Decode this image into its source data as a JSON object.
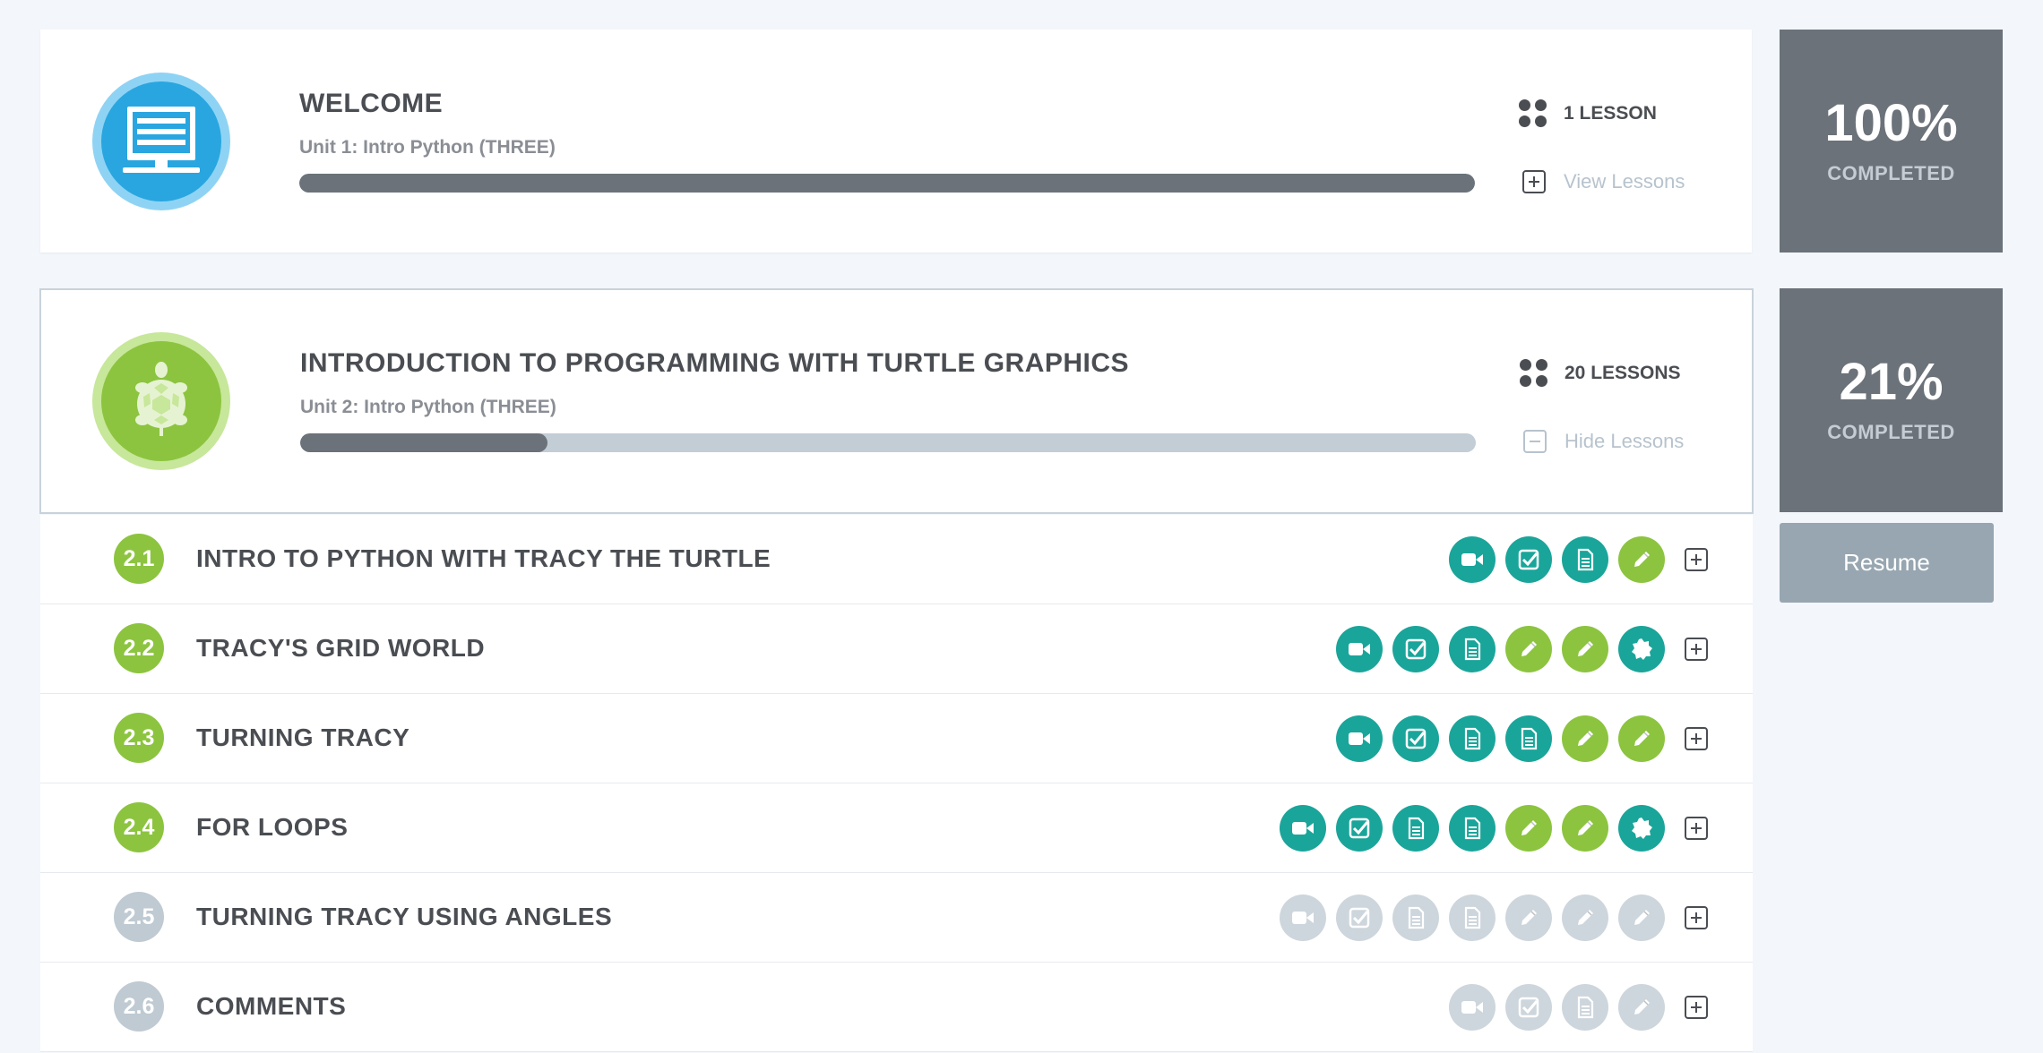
{
  "units": [
    {
      "title": "WELCOME",
      "subtitle": "Unit 1: Intro Python (THREE)",
      "progress": 1.0,
      "lessons_label": "1 LESSON",
      "toggle_label": "View Lessons",
      "percent": "100%",
      "completed_label": "COMPLETED",
      "icon": "monitor-icon",
      "color": "#29a6e0"
    },
    {
      "title": "INTRODUCTION TO PROGRAMMING WITH TURTLE GRAPHICS",
      "subtitle": "Unit 2: Intro Python (THREE)",
      "progress": 0.21,
      "lessons_label": "20 LESSONS",
      "toggle_label": "Hide Lessons",
      "percent": "21%",
      "completed_label": "COMPLETED",
      "icon": "turtle-icon",
      "color": "#8cc43f"
    }
  ],
  "resume_label": "Resume",
  "lessons": [
    {
      "num": "2.1",
      "title": "INTRO TO PYTHON WITH TRACY THE TURTLE",
      "done": true,
      "activities": [
        [
          "video",
          "teal"
        ],
        [
          "quiz",
          "teal"
        ],
        [
          "doc",
          "teal"
        ],
        [
          "exercise",
          "green"
        ]
      ]
    },
    {
      "num": "2.2",
      "title": "TRACY'S GRID WORLD",
      "done": true,
      "activities": [
        [
          "video",
          "teal"
        ],
        [
          "quiz",
          "teal"
        ],
        [
          "doc",
          "teal"
        ],
        [
          "exercise",
          "green"
        ],
        [
          "exercise",
          "green"
        ],
        [
          "badge",
          "teal"
        ]
      ]
    },
    {
      "num": "2.3",
      "title": "TURNING TRACY",
      "done": true,
      "activities": [
        [
          "video",
          "teal"
        ],
        [
          "quiz",
          "teal"
        ],
        [
          "doc",
          "teal"
        ],
        [
          "doc",
          "teal"
        ],
        [
          "exercise",
          "green"
        ],
        [
          "exercise",
          "green"
        ]
      ]
    },
    {
      "num": "2.4",
      "title": "FOR LOOPS",
      "done": true,
      "activities": [
        [
          "video",
          "teal"
        ],
        [
          "quiz",
          "teal"
        ],
        [
          "doc",
          "teal"
        ],
        [
          "doc",
          "teal"
        ],
        [
          "exercise",
          "green"
        ],
        [
          "exercise",
          "green"
        ],
        [
          "badge",
          "teal"
        ]
      ]
    },
    {
      "num": "2.5",
      "title": "TURNING TRACY USING ANGLES",
      "done": false,
      "activities": [
        [
          "video",
          "grey"
        ],
        [
          "quiz",
          "grey"
        ],
        [
          "doc",
          "grey"
        ],
        [
          "doc",
          "grey"
        ],
        [
          "exercise",
          "grey"
        ],
        [
          "exercise",
          "grey"
        ],
        [
          "exercise",
          "grey"
        ]
      ]
    },
    {
      "num": "2.6",
      "title": "COMMENTS",
      "done": false,
      "activities": [
        [
          "video",
          "grey"
        ],
        [
          "quiz",
          "grey"
        ],
        [
          "doc",
          "grey"
        ],
        [
          "exercise",
          "grey"
        ]
      ]
    }
  ]
}
